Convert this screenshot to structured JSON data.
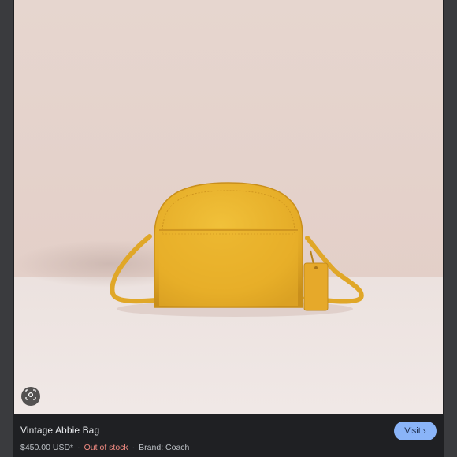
{
  "product": {
    "title": "Vintage Abbie Bag",
    "price": "$450.00 USD*",
    "stock_status": "Out of stock",
    "brand": "Brand: Coach",
    "separator": "·"
  },
  "actions": {
    "visit_label": "Visit",
    "visit_chevron": "›",
    "lens_icon": "lens-search-icon"
  },
  "image": {
    "subject": "yellow leather crossbody bag",
    "background_color": "#e8d6d0",
    "floor_color": "#efe4e1",
    "bag_color": "#e8b12b"
  }
}
